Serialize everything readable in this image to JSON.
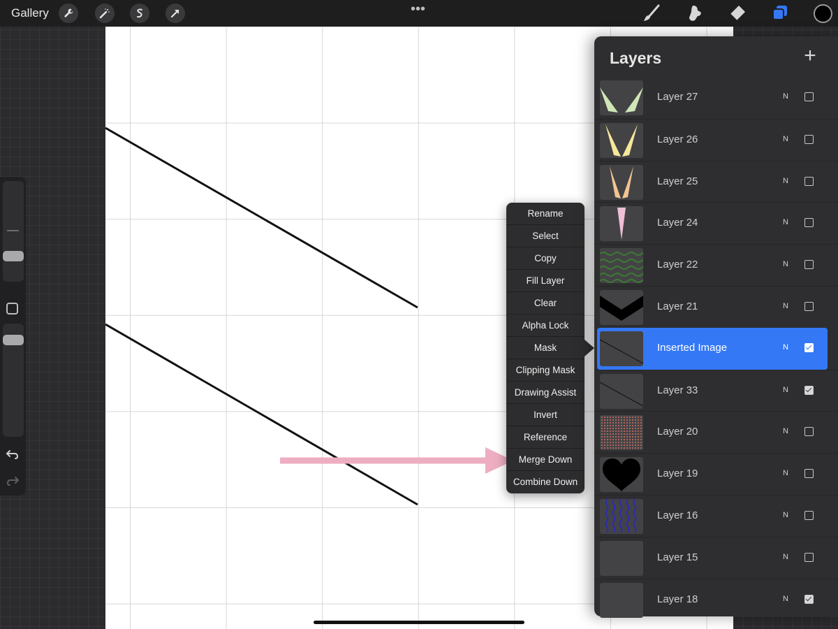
{
  "toolbar": {
    "gallery_label": "Gallery",
    "left_icons": [
      "wrench-icon",
      "magic-wand-icon",
      "selection-icon",
      "transform-arrow-icon"
    ],
    "right_tools": [
      "brush-icon",
      "smudge-icon",
      "eraser-icon",
      "layers-icon"
    ],
    "active_tool": "layers-icon",
    "current_color": "#000000"
  },
  "layers": {
    "title": "Layers",
    "add_label": "+",
    "items": [
      {
        "name": "Layer 27",
        "blend": "N",
        "visible": false,
        "thumb": "green-chevron"
      },
      {
        "name": "Layer 26",
        "blend": "N",
        "visible": false,
        "thumb": "yellow-chevron"
      },
      {
        "name": "Layer 25",
        "blend": "N",
        "visible": false,
        "thumb": "orange-chevron"
      },
      {
        "name": "Layer 24",
        "blend": "N",
        "visible": false,
        "thumb": "pink-spike"
      },
      {
        "name": "Layer 22",
        "blend": "N",
        "visible": false,
        "thumb": "green-waves"
      },
      {
        "name": "Layer 21",
        "blend": "N",
        "visible": false,
        "thumb": "black-chevron"
      },
      {
        "name": "Inserted Image",
        "blend": "N",
        "visible": true,
        "selected": true,
        "thumb": "diagonal-line"
      },
      {
        "name": "Layer 33",
        "blend": "N",
        "visible": true,
        "thumb": "diagonal-line"
      },
      {
        "name": "Layer 20",
        "blend": "N",
        "visible": false,
        "thumb": "red-dots"
      },
      {
        "name": "Layer 19",
        "blend": "N",
        "visible": false,
        "thumb": "black-heart"
      },
      {
        "name": "Layer 16",
        "blend": "N",
        "visible": false,
        "thumb": "blue-squiggles"
      },
      {
        "name": "Layer 15",
        "blend": "N",
        "visible": false,
        "thumb": "empty"
      },
      {
        "name": "Layer 18",
        "blend": "N",
        "visible": true,
        "thumb": "empty"
      }
    ]
  },
  "context_menu": {
    "items": [
      "Rename",
      "Select",
      "Copy",
      "Fill Layer",
      "Clear",
      "Alpha Lock",
      "Mask",
      "Clipping Mask",
      "Drawing Assist",
      "Invert",
      "Reference",
      "Merge Down",
      "Combine Down"
    ],
    "highlighted_item": "Merge Down"
  },
  "colors": {
    "accent": "#3478f6",
    "annotation_arrow": "#eeaec2"
  }
}
